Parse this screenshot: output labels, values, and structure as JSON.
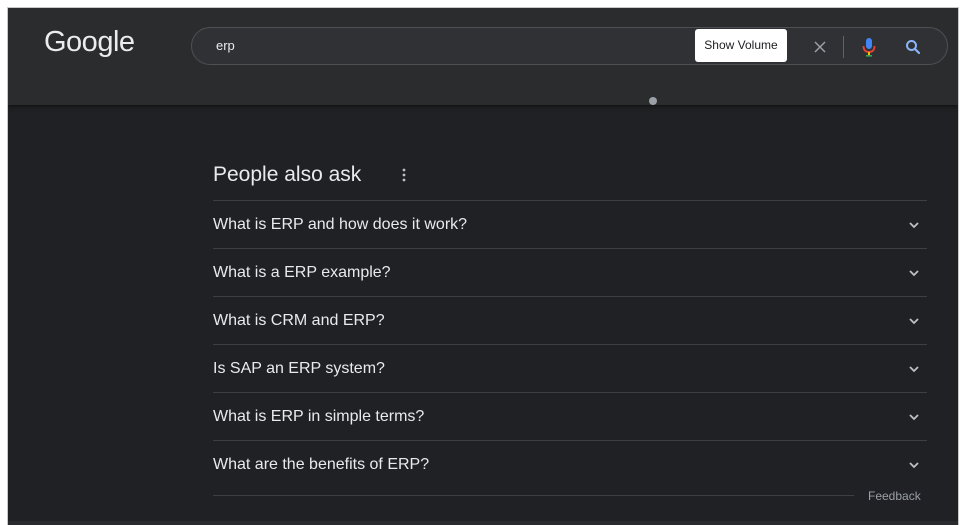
{
  "header": {
    "logo_text": "Google",
    "search": {
      "query": "erp",
      "tooltip": "Show Volume",
      "icons": [
        "close-icon",
        "mic-icon",
        "search-icon"
      ]
    }
  },
  "people_also_ask": {
    "title": "People also ask",
    "questions": [
      "What is ERP and how does it work?",
      "What is a ERP example?",
      "What is CRM and ERP?",
      "Is SAP an ERP system?",
      "What is ERP in simple terms?",
      "What are the benefits of ERP?"
    ],
    "feedback_label": "Feedback"
  },
  "colors": {
    "background": "#202124",
    "header_bg": "#2b2c2e",
    "text": "#e8eaed",
    "muted": "#9aa0a6",
    "divider": "#3c4043",
    "mic_blue": "#4285f4",
    "mic_red": "#ea4335",
    "search_icon": "#8ab4f8"
  }
}
